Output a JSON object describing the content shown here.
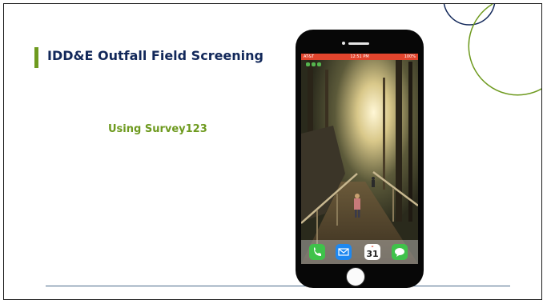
{
  "slide": {
    "title": "IDD&E Outfall Field Screening",
    "subtitle": "Using Survey123"
  },
  "phone": {
    "status_bar": {
      "carrier": "AT&T",
      "time": "12:51 PM",
      "battery": "100%"
    },
    "dock_apps": [
      {
        "icon": "phone-icon"
      },
      {
        "icon": "mail-icon"
      },
      {
        "icon": "calendar-icon",
        "date": "31"
      },
      {
        "icon": "messages-icon"
      }
    ]
  },
  "colors": {
    "title": "#12285a",
    "accent_green": "#6e9a1f",
    "status_bar": "#e2452d"
  }
}
